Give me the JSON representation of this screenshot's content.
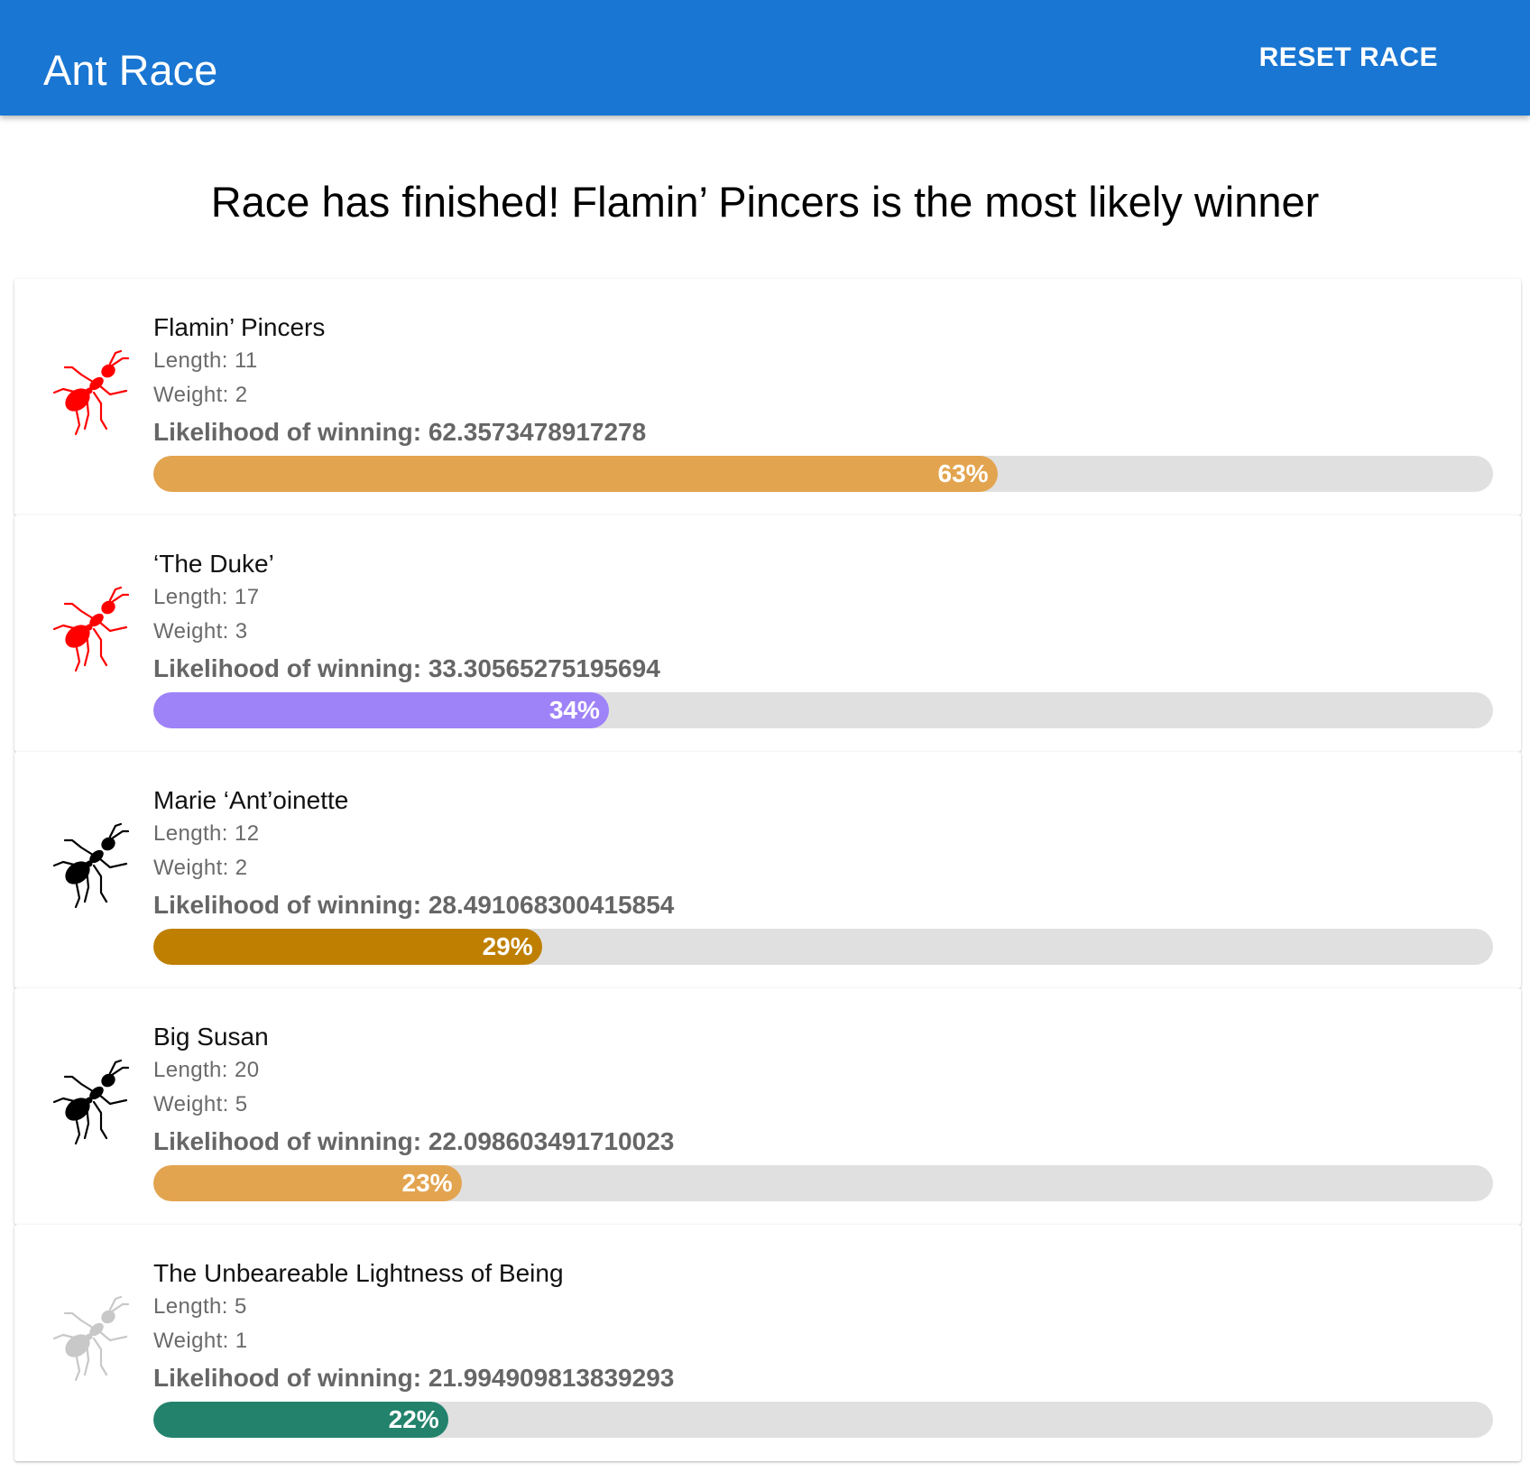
{
  "app": {
    "title": "Ant Race",
    "reset_label": "RESET RACE",
    "brand_color": "#1976d2"
  },
  "status_message": "Race has finished! Flamin’ Pincers is the most likely winner",
  "ants": [
    {
      "name": "Flamin’ Pincers",
      "length_text": "Length: 11",
      "weight_text": "Weight: 2",
      "likelihood_text": "Likelihood of winning: 62.3573478917278",
      "percent_label": "63%",
      "progress": 0.63,
      "bar_color": "#e3a44f",
      "ant_color": "#ff0000",
      "icon": "ant-icon"
    },
    {
      "name": "‘The Duke’",
      "length_text": "Length: 17",
      "weight_text": "Weight: 3",
      "likelihood_text": "Likelihood of winning: 33.30565275195694",
      "percent_label": "34%",
      "progress": 0.34,
      "bar_color": "#9e82f8",
      "ant_color": "#ff0000",
      "icon": "ant-icon"
    },
    {
      "name": "Marie ‘Ant’oinette",
      "length_text": "Length: 12",
      "weight_text": "Weight: 2",
      "likelihood_text": "Likelihood of winning: 28.491068300415854",
      "percent_label": "29%",
      "progress": 0.29,
      "bar_color": "#bf7f00",
      "ant_color": "#000000",
      "icon": "ant-icon"
    },
    {
      "name": "Big Susan",
      "length_text": "Length: 20",
      "weight_text": "Weight: 5",
      "likelihood_text": "Likelihood of winning: 22.098603491710023",
      "percent_label": "23%",
      "progress": 0.23,
      "bar_color": "#e3a44f",
      "ant_color": "#000000",
      "icon": "ant-icon"
    },
    {
      "name": "The Unbeareable Lightness of Being",
      "length_text": "Length: 5",
      "weight_text": "Weight: 1",
      "likelihood_text": "Likelihood of winning: 21.994909813839293",
      "percent_label": "22%",
      "progress": 0.22,
      "bar_color": "#22826c",
      "ant_color": "#c8c8c8",
      "icon": "ant-icon"
    }
  ]
}
